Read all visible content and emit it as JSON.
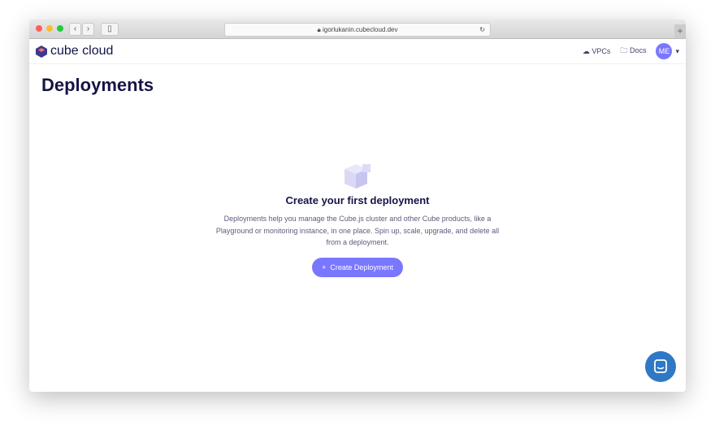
{
  "browser": {
    "url": "igorlukanin.cubecloud.dev"
  },
  "nav": {
    "logo": "cube cloud",
    "vpcs": "VPCs",
    "docs": "Docs",
    "avatar": "ME"
  },
  "page": {
    "title": "Deployments"
  },
  "empty_state": {
    "title": "Create your first deployment",
    "description": "Deployments help you manage the Cube.js cluster and other Cube products, like a Playground or monitoring instance, in one place. Spin up, scale, upgrade, and delete all from a deployment.",
    "button": "Create Deployment",
    "button_icon": "+"
  },
  "colors": {
    "accent": "#7a77ff",
    "heading": "#141446",
    "chat": "#2f78c4"
  }
}
